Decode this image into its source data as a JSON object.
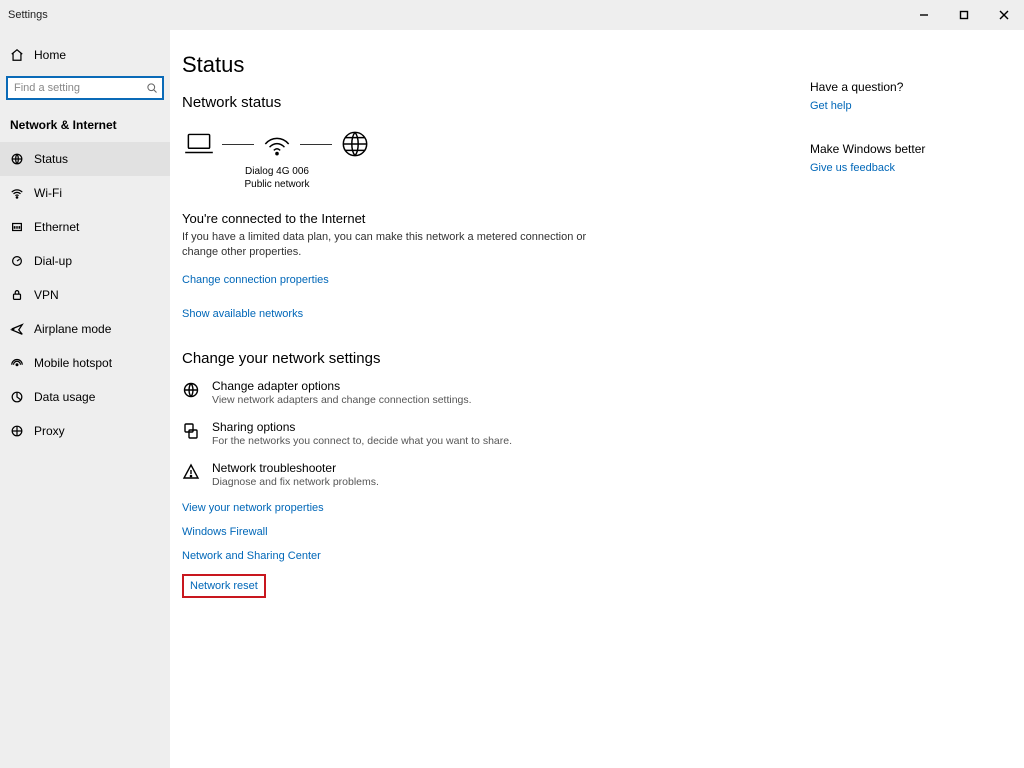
{
  "window": {
    "title": "Settings"
  },
  "sidebar": {
    "home": "Home",
    "search_placeholder": "Find a setting",
    "section": "Network & Internet",
    "items": [
      {
        "label": "Status"
      },
      {
        "label": "Wi-Fi"
      },
      {
        "label": "Ethernet"
      },
      {
        "label": "Dial-up"
      },
      {
        "label": "VPN"
      },
      {
        "label": "Airplane mode"
      },
      {
        "label": "Mobile hotspot"
      },
      {
        "label": "Data usage"
      },
      {
        "label": "Proxy"
      }
    ]
  },
  "main": {
    "page_title": "Status",
    "status_heading": "Network status",
    "network_name": "Dialog 4G 006",
    "network_type": "Public network",
    "connected_title": "You're connected to the Internet",
    "connected_body": "If you have a limited data plan, you can make this network a metered connection or change other properties.",
    "link_change_conn": "Change connection properties",
    "link_show_avail": "Show available networks",
    "change_heading": "Change your network settings",
    "options": [
      {
        "title": "Change adapter options",
        "sub": "View network adapters and change connection settings."
      },
      {
        "title": "Sharing options",
        "sub": "For the networks you connect to, decide what you want to share."
      },
      {
        "title": "Network troubleshooter",
        "sub": "Diagnose and fix network problems."
      }
    ],
    "link_view_props": "View your network properties",
    "link_firewall": "Windows Firewall",
    "link_sharing_center": "Network and Sharing Center",
    "link_reset": "Network reset"
  },
  "right": {
    "q_title": "Have a question?",
    "q_link": "Get help",
    "fb_title": "Make Windows better",
    "fb_link": "Give us feedback"
  }
}
